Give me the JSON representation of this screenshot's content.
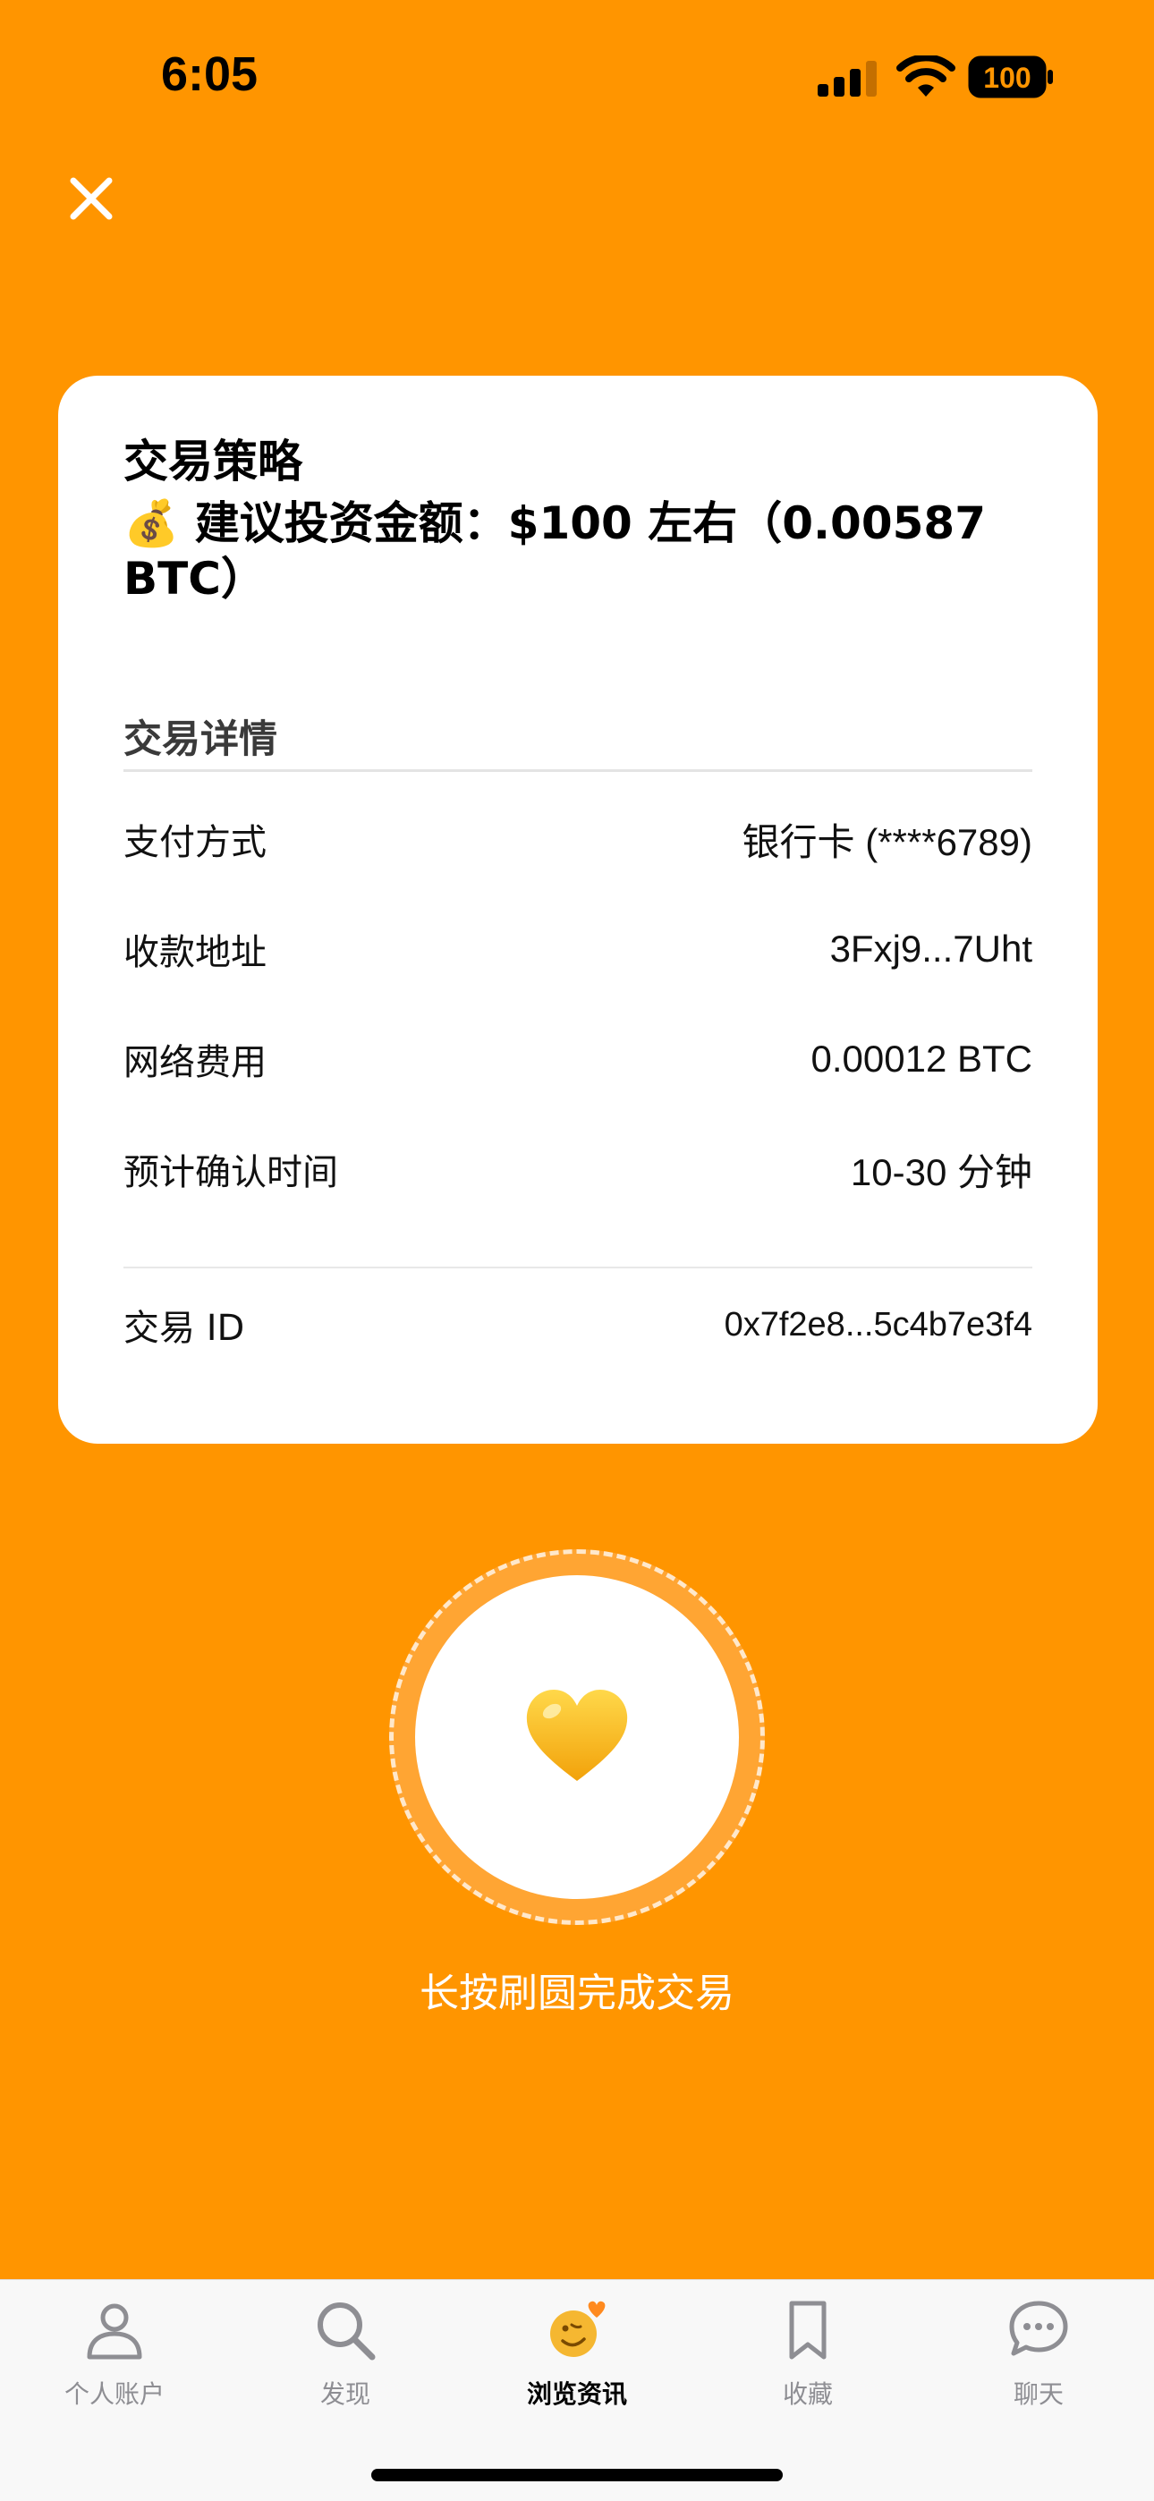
{
  "status_bar": {
    "time": "6:05",
    "battery": "100"
  },
  "close_icon": "close-icon",
  "card": {
    "title": "交易策略",
    "amount_emoji": "💰",
    "amount_text": "建议投资金额：$100 左右（0.00587 BTC）",
    "details_heading": "交易详情",
    "rows": [
      {
        "label": "支付方式",
        "value": "银行卡 (****6789)"
      },
      {
        "label": "收款地址",
        "value": "3Fxj9...7Uht"
      },
      {
        "label": "网络费用",
        "value": "0.00012 BTC"
      },
      {
        "label": "预计确认时间",
        "value": "10-30 分钟"
      }
    ],
    "transaction_id": {
      "label": "交易 ID",
      "value": "0x7f2e8...5c4b7e3f4"
    }
  },
  "action": {
    "emoji": "💛",
    "hint": "长按刷圆完成交易"
  },
  "tab_bar": {
    "tabs": [
      {
        "label": "个人账户",
        "icon": "person-icon",
        "active": false
      },
      {
        "label": "发现",
        "icon": "search-icon",
        "active": false
      },
      {
        "label": "浏览资讯",
        "icon": "smiley-heart-icon",
        "active": true
      },
      {
        "label": "收藏",
        "icon": "bookmark-icon",
        "active": false
      },
      {
        "label": "聊天",
        "icon": "chat-bubble-icon",
        "active": false
      }
    ]
  },
  "colors": {
    "background": "#FF9500",
    "card": "#FFFFFF",
    "accent_ring": "#FFA533"
  }
}
